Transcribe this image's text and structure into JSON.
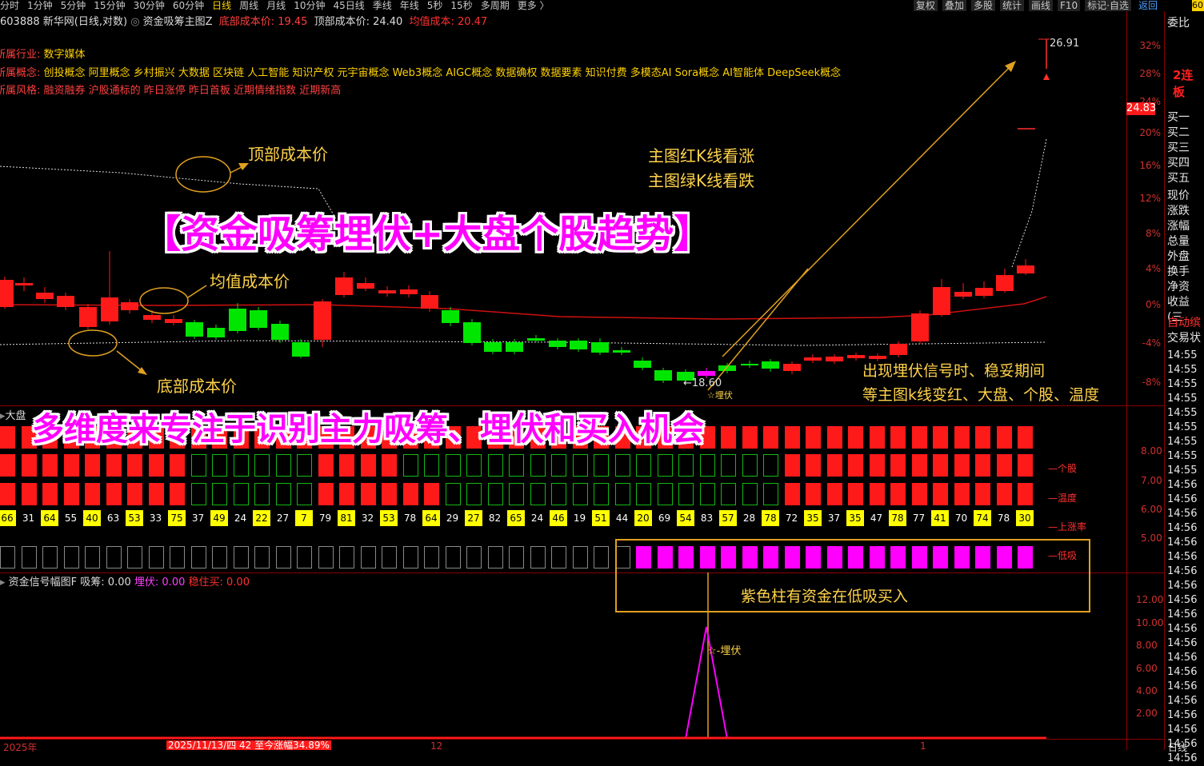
{
  "toolbar": {
    "periods": [
      "分时",
      "1分钟",
      "5分钟",
      "15分钟",
      "30分钟",
      "60分钟",
      "日线",
      "周线",
      "月线",
      "10分钟",
      "45日线",
      "季线",
      "年线",
      "5秒",
      "15秒",
      "多周期",
      "更多 〉"
    ],
    "active_period": "日线",
    "right_buttons": [
      "复权",
      "叠加",
      "多股",
      "统计",
      "画线",
      "F10",
      "标记·自选"
    ],
    "back": "返回"
  },
  "header": {
    "stock": "603888 新华网(日线,对数)",
    "indicator": "资金吸筹主图Z",
    "bottom_cost": "底部成本价: 19.45",
    "top_cost": "顶部成本价: 24.40",
    "avg_cost": "均值成本: 20.47"
  },
  "concepts": {
    "industry_label": "所属行业:",
    "industry": "数字媒体",
    "concept_label": "所属概念:",
    "concept": "创投概念 阿里概念 乡村振兴 大数据 区块链 人工智能 知识产权 元宇宙概念 Web3概念 AIGC概念 数据确权 数据要素 知识付费 多模态AI Sora概念 AI智能体 DeepSeek概念",
    "style_label": "所属风格:",
    "style": "融资融券 沪股通标的 昨日涨停 昨日首板 近期情绪指数 近期新高"
  },
  "main_chart": {
    "price_high": "26.91",
    "price_low": "←18.60",
    "current_price": "24.83",
    "pct_ticks": [
      "32%",
      "28%",
      "24%",
      "20%",
      "16%",
      "12%",
      "8%",
      "4%",
      "0%",
      "-4%",
      "-8%"
    ],
    "colors": {
      "up": "#ff1a1a",
      "down": "#00e600",
      "signal": "#ff00ff",
      "gold": "#ffd24a"
    }
  },
  "annotations": {
    "top_cost": "顶部成本价",
    "avg_cost": "均值成本价",
    "bottom_cost": "底部成本价",
    "red_green_1": "主图红K线看涨",
    "red_green_2": "主图绿K线看跌",
    "buy_tip_1": "出现埋伏信号时、稳妥期间",
    "buy_tip_2": "等主图k线变红、大盘、个股、温度",
    "purple": "紫色柱有资金在低吸买入",
    "ambush_marker": "☆-埋伏",
    "ambush_small": "☆埋伏"
  },
  "banners": {
    "title": "【资金吸筹埋伏+大盘个股趋势】",
    "subtitle": "多维度来专注于识别主力吸筹、埋伏和买入机会"
  },
  "sub_panel": {
    "label": "大盘",
    "rows": [
      "个股",
      "温度",
      "上涨率",
      "低吸"
    ],
    "axis": [
      "8.00",
      "7.00",
      "6.00",
      "5.00"
    ],
    "numbers": [
      "66",
      "31",
      "64",
      "55",
      "40",
      "63",
      "53",
      "33",
      "75",
      "37",
      "49",
      "24",
      "22",
      "27",
      "7",
      "79",
      "81",
      "32",
      "53",
      "78",
      "64",
      "29",
      "27",
      "82",
      "65",
      "24",
      "46",
      "19",
      "51",
      "44",
      "20",
      "69",
      "54",
      "83",
      "57",
      "28",
      "78",
      "72",
      "35",
      "37",
      "35",
      "47",
      "78",
      "77",
      "41",
      "70",
      "74",
      "78",
      "30"
    ]
  },
  "signal_panel": {
    "title": "资金信号幅图F",
    "xichou": "吸筹: 0.00",
    "maifu": "埋伏: 0.00",
    "wenzhu": "稳住买: 0.00",
    "axis": [
      "12.00",
      "10.00",
      "8.00",
      "6.00",
      "4.00",
      "2.00"
    ]
  },
  "bottom_axis": {
    "year": "2025年",
    "date": "2025/11/13/四 42 至今涨幅34.89%",
    "dec": "12",
    "jan": "1",
    "right_tab": "日线"
  },
  "right_panel": {
    "top_label": "委比",
    "limit": "2连板",
    "buy": [
      "买一",
      "买二",
      "买三",
      "买四",
      "买五"
    ],
    "fields": [
      "现价",
      "涨跌",
      "涨幅",
      "总量",
      "外盘",
      "换手",
      "净资",
      "收益(三"
    ],
    "auto": "自动缤",
    "trade": "交易状",
    "times": [
      "14:55",
      "14:55",
      "14:55",
      "14:55",
      "14:55",
      "14:55",
      "14:55",
      "14:55",
      "14:55",
      "14:56",
      "14:56",
      "14:56",
      "14:56",
      "14:56",
      "14:56",
      "14:56",
      "14:56",
      "14:56",
      "14:56",
      "14:56",
      "14:56",
      "14:56",
      "14:56",
      "14:56",
      "14:56",
      "14:56",
      "14:56",
      "14:56",
      "14:56"
    ]
  }
}
